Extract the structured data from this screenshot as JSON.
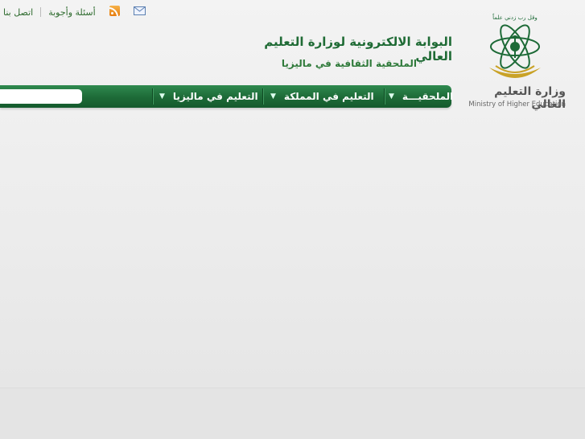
{
  "topbar": {
    "links": [
      "أسئلة وأجوبة",
      "اتصل بنا"
    ],
    "icons": [
      "rss-icon",
      "mail-icon"
    ]
  },
  "header": {
    "title": "البوابة الالكترونية لوزارة التعليم العالي",
    "subtitle": "الملحقية الثقافية في ماليزيا"
  },
  "logo": {
    "name_ar": "وزارة التعليم العالي",
    "name_en": "Ministry of Higher Education",
    "motto": "وقل رب زدني علماً",
    "colors": {
      "green": "#1d6a37",
      "gold": "#c9a227"
    }
  },
  "nav": {
    "items": [
      "الملحقيـــة",
      "التعليم في المملكة",
      "التعليم في ماليزيا"
    ],
    "search_placeholder": ""
  },
  "colors": {
    "nav_green": "#1d6a37",
    "link_green": "#2e6b2e",
    "background": "#ededed"
  }
}
